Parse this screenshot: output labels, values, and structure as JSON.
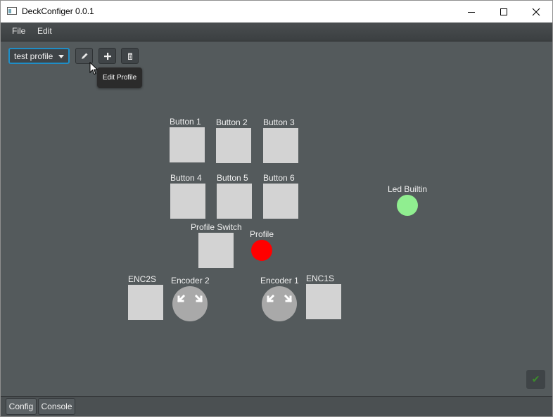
{
  "window": {
    "title": "DeckConfiger 0.0.1"
  },
  "menu": {
    "file": "File",
    "edit": "Edit"
  },
  "toolbar": {
    "profile_selected": "test profile",
    "edit_tooltip": "Edit Profile"
  },
  "elements": {
    "button1": "Button 1",
    "button2": "Button 2",
    "button3": "Button 3",
    "button4": "Button 4",
    "button5": "Button 5",
    "button6": "Button 6",
    "profile_switch": "Profile Switch",
    "profile": "Profile",
    "led_builtin": "Led Builtin",
    "enc2s": "ENC2S",
    "encoder2": "Encoder 2",
    "encoder1": "Encoder 1",
    "enc1s": "ENC1S"
  },
  "colors": {
    "profile_led": "#ff0000",
    "builtin_led": "#90ee90",
    "select_border": "#1f8ec7"
  },
  "tabs": {
    "config": "Config",
    "console": "Console"
  }
}
